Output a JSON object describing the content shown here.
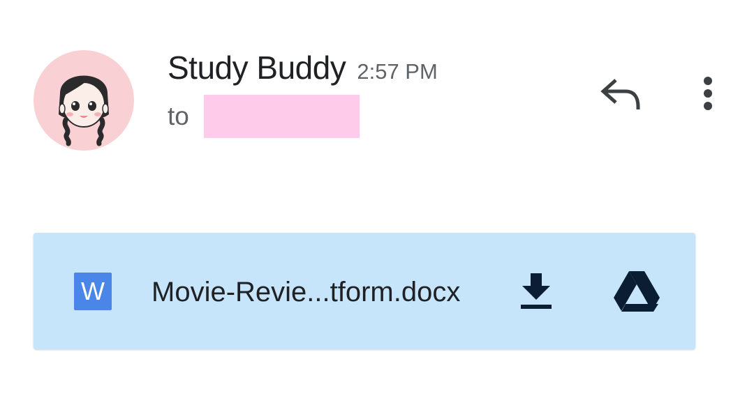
{
  "message": {
    "sender_name": "Study Buddy",
    "time": "2:57 PM",
    "to_label": "to",
    "recipient": "",
    "reply_icon": "reply-icon",
    "more_icon": "more-vert-icon",
    "avatar_icon": "avatar-girl-illustration"
  },
  "attachment": {
    "type_letter": "W",
    "filename": "Movie-Revie...tform.docx",
    "file_icon": "word-doc-icon",
    "download_icon": "download-icon",
    "drive_icon": "google-drive-icon"
  },
  "colors": {
    "attachment_bg": "#c6e5fb",
    "doc_icon_bg": "#4a86e8",
    "avatar_bg": "#f9d0d3",
    "redaction": "#ffcbea",
    "icon_dark": "#0b1d33"
  }
}
